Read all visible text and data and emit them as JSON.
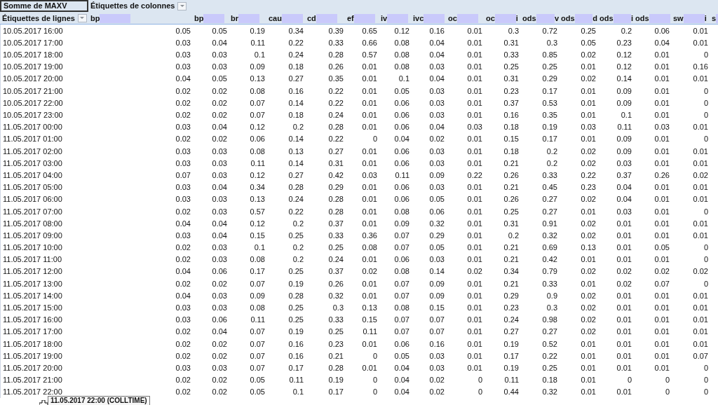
{
  "pivot": {
    "value_field": "Somme de MAXV",
    "column_labels": "Étiquettes de colonnes",
    "row_labels": "Étiquettes de lignes"
  },
  "columns": [
    {
      "prefix": "bp"
    },
    {
      "prefix": "bp"
    },
    {
      "prefix": "br"
    },
    {
      "prefix": "cau"
    },
    {
      "prefix": "cd"
    },
    {
      "prefix": "ef"
    },
    {
      "prefix": "iv"
    },
    {
      "prefix": "ivc"
    },
    {
      "prefix": "oc"
    },
    {
      "prefix": "oc",
      "suffix": "i"
    },
    {
      "prefix": "ods",
      "suffix": "v"
    },
    {
      "prefix": "ods",
      "suffix": "d"
    },
    {
      "prefix": "ods",
      "suffix": "i"
    },
    {
      "prefix": "ods"
    },
    {
      "prefix": "sw",
      "suffix": "i"
    },
    {
      "prefix": "s"
    }
  ],
  "rows": [
    {
      "label": "10.05.2017 16:00",
      "values": [
        "0.05",
        "0.05",
        "0.19",
        "0.34",
        "0.39",
        "0.65",
        "0.12",
        "0.16",
        "0.01",
        "0.3",
        "0.72",
        "0.25",
        "0.2",
        "0.06",
        "0.01"
      ]
    },
    {
      "label": "10.05.2017 17:00",
      "values": [
        "0.03",
        "0.04",
        "0.11",
        "0.22",
        "0.33",
        "0.66",
        "0.08",
        "0.04",
        "0.01",
        "0.31",
        "0.3",
        "0.05",
        "0.23",
        "0.04",
        "0.01"
      ]
    },
    {
      "label": "10.05.2017 18:00",
      "values": [
        "0.03",
        "0.03",
        "0.1",
        "0.24",
        "0.28",
        "0.57",
        "0.08",
        "0.04",
        "0.01",
        "0.33",
        "0.85",
        "0.02",
        "0.12",
        "0.01",
        "0"
      ]
    },
    {
      "label": "10.05.2017 19:00",
      "values": [
        "0.03",
        "0.03",
        "0.09",
        "0.18",
        "0.26",
        "0.01",
        "0.08",
        "0.03",
        "0.01",
        "0.25",
        "0.25",
        "0.01",
        "0.12",
        "0.01",
        "0.16"
      ]
    },
    {
      "label": "10.05.2017 20:00",
      "values": [
        "0.04",
        "0.05",
        "0.13",
        "0.27",
        "0.35",
        "0.01",
        "0.1",
        "0.04",
        "0.01",
        "0.31",
        "0.29",
        "0.02",
        "0.14",
        "0.01",
        "0.01"
      ]
    },
    {
      "label": "10.05.2017 21:00",
      "values": [
        "0.02",
        "0.02",
        "0.08",
        "0.16",
        "0.22",
        "0.01",
        "0.05",
        "0.03",
        "0.01",
        "0.23",
        "0.17",
        "0.01",
        "0.09",
        "0.01",
        "0"
      ]
    },
    {
      "label": "10.05.2017 22:00",
      "values": [
        "0.02",
        "0.02",
        "0.07",
        "0.14",
        "0.22",
        "0.01",
        "0.06",
        "0.03",
        "0.01",
        "0.37",
        "0.53",
        "0.01",
        "0.09",
        "0.01",
        "0"
      ]
    },
    {
      "label": "10.05.2017 23:00",
      "values": [
        "0.02",
        "0.02",
        "0.07",
        "0.18",
        "0.24",
        "0.01",
        "0.06",
        "0.03",
        "0.01",
        "0.16",
        "0.35",
        "0.01",
        "0.1",
        "0.01",
        "0"
      ]
    },
    {
      "label": "11.05.2017 00:00",
      "values": [
        "0.03",
        "0.04",
        "0.12",
        "0.2",
        "0.28",
        "0.01",
        "0.06",
        "0.04",
        "0.03",
        "0.18",
        "0.19",
        "0.03",
        "0.11",
        "0.03",
        "0.01"
      ]
    },
    {
      "label": "11.05.2017 01:00",
      "values": [
        "0.02",
        "0.02",
        "0.06",
        "0.14",
        "0.22",
        "0",
        "0.04",
        "0.02",
        "0.01",
        "0.15",
        "0.17",
        "0.01",
        "0.09",
        "0.01",
        "0"
      ]
    },
    {
      "label": "11.05.2017 02:00",
      "values": [
        "0.03",
        "0.03",
        "0.08",
        "0.13",
        "0.27",
        "0.01",
        "0.06",
        "0.03",
        "0.01",
        "0.18",
        "0.2",
        "0.02",
        "0.09",
        "0.01",
        "0.01"
      ]
    },
    {
      "label": "11.05.2017 03:00",
      "values": [
        "0.03",
        "0.03",
        "0.11",
        "0.14",
        "0.31",
        "0.01",
        "0.06",
        "0.03",
        "0.01",
        "0.21",
        "0.2",
        "0.02",
        "0.03",
        "0.01",
        "0.01"
      ]
    },
    {
      "label": "11.05.2017 04:00",
      "values": [
        "0.07",
        "0.03",
        "0.12",
        "0.27",
        "0.42",
        "0.03",
        "0.11",
        "0.09",
        "0.22",
        "0.26",
        "0.33",
        "0.22",
        "0.37",
        "0.26",
        "0.02"
      ]
    },
    {
      "label": "11.05.2017 05:00",
      "values": [
        "0.03",
        "0.04",
        "0.34",
        "0.28",
        "0.29",
        "0.01",
        "0.06",
        "0.03",
        "0.01",
        "0.21",
        "0.45",
        "0.23",
        "0.04",
        "0.01",
        "0.01"
      ]
    },
    {
      "label": "11.05.2017 06:00",
      "values": [
        "0.03",
        "0.03",
        "0.13",
        "0.24",
        "0.28",
        "0.01",
        "0.06",
        "0.05",
        "0.01",
        "0.26",
        "0.27",
        "0.02",
        "0.04",
        "0.01",
        "0.01"
      ]
    },
    {
      "label": "11.05.2017 07:00",
      "values": [
        "0.02",
        "0.03",
        "0.57",
        "0.22",
        "0.28",
        "0.01",
        "0.08",
        "0.06",
        "0.01",
        "0.25",
        "0.27",
        "0.01",
        "0.03",
        "0.01",
        "0"
      ]
    },
    {
      "label": "11.05.2017 08:00",
      "values": [
        "0.04",
        "0.04",
        "0.12",
        "0.2",
        "0.37",
        "0.01",
        "0.09",
        "0.32",
        "0.01",
        "0.31",
        "0.91",
        "0.02",
        "0.01",
        "0.01",
        "0.01"
      ]
    },
    {
      "label": "11.05.2017 09:00",
      "values": [
        "0.03",
        "0.04",
        "0.15",
        "0.25",
        "0.33",
        "0.36",
        "0.07",
        "0.29",
        "0.01",
        "0.2",
        "0.32",
        "0.02",
        "0.01",
        "0.01",
        "0.01"
      ]
    },
    {
      "label": "11.05.2017 10:00",
      "values": [
        "0.02",
        "0.03",
        "0.1",
        "0.2",
        "0.25",
        "0.08",
        "0.07",
        "0.05",
        "0.01",
        "0.21",
        "0.69",
        "0.13",
        "0.01",
        "0.05",
        "0"
      ]
    },
    {
      "label": "11.05.2017 11:00",
      "values": [
        "0.02",
        "0.03",
        "0.08",
        "0.2",
        "0.24",
        "0.01",
        "0.06",
        "0.03",
        "0.01",
        "0.21",
        "0.42",
        "0.01",
        "0.01",
        "0.01",
        "0"
      ]
    },
    {
      "label": "11.05.2017 12:00",
      "values": [
        "0.04",
        "0.06",
        "0.17",
        "0.25",
        "0.37",
        "0.02",
        "0.08",
        "0.14",
        "0.02",
        "0.34",
        "0.79",
        "0.02",
        "0.02",
        "0.02",
        "0.02"
      ]
    },
    {
      "label": "11.05.2017 13:00",
      "values": [
        "0.02",
        "0.02",
        "0.07",
        "0.19",
        "0.26",
        "0.01",
        "0.07",
        "0.09",
        "0.01",
        "0.21",
        "0.33",
        "0.01",
        "0.02",
        "0.07",
        "0"
      ]
    },
    {
      "label": "11.05.2017 14:00",
      "values": [
        "0.04",
        "0.03",
        "0.09",
        "0.28",
        "0.32",
        "0.01",
        "0.07",
        "0.09",
        "0.01",
        "0.29",
        "0.9",
        "0.02",
        "0.01",
        "0.01",
        "0.01"
      ]
    },
    {
      "label": "11.05.2017 15:00",
      "values": [
        "0.03",
        "0.03",
        "0.08",
        "0.25",
        "0.3",
        "0.13",
        "0.08",
        "0.15",
        "0.01",
        "0.23",
        "0.3",
        "0.02",
        "0.01",
        "0.01",
        "0.01"
      ]
    },
    {
      "label": "11.05.2017 16:00",
      "values": [
        "0.03",
        "0.06",
        "0.11",
        "0.25",
        "0.33",
        "0.15",
        "0.07",
        "0.07",
        "0.01",
        "0.24",
        "0.98",
        "0.02",
        "0.01",
        "0.01",
        "0.01"
      ]
    },
    {
      "label": "11.05.2017 17:00",
      "values": [
        "0.02",
        "0.04",
        "0.07",
        "0.19",
        "0.25",
        "0.11",
        "0.07",
        "0.07",
        "0.01",
        "0.27",
        "0.27",
        "0.02",
        "0.01",
        "0.01",
        "0.01"
      ]
    },
    {
      "label": "11.05.2017 18:00",
      "values": [
        "0.02",
        "0.02",
        "0.07",
        "0.16",
        "0.23",
        "0.01",
        "0.06",
        "0.16",
        "0.01",
        "0.19",
        "0.52",
        "0.01",
        "0.01",
        "0.01",
        "0.01"
      ]
    },
    {
      "label": "11.05.2017 19:00",
      "values": [
        "0.02",
        "0.02",
        "0.07",
        "0.16",
        "0.21",
        "0",
        "0.05",
        "0.03",
        "0.01",
        "0.17",
        "0.22",
        "0.01",
        "0.01",
        "0.01",
        "0.07"
      ]
    },
    {
      "label": "11.05.2017 20:00",
      "values": [
        "0.03",
        "0.03",
        "0.07",
        "0.17",
        "0.28",
        "0.01",
        "0.04",
        "0.03",
        "0.01",
        "0.19",
        "0.25",
        "0.01",
        "0.01",
        "0.01",
        "0"
      ]
    },
    {
      "label": "11.05.2017 21:00",
      "values": [
        "0.02",
        "0.02",
        "0.05",
        "0.11",
        "0.19",
        "0",
        "0.04",
        "0.02",
        "0",
        "0.11",
        "0.18",
        "0.01",
        "0",
        "0",
        "0"
      ]
    },
    {
      "label": "11.05.2017 22:00",
      "values": [
        "0.02",
        "0.02",
        "0.05",
        "0.1",
        "0.17",
        "0",
        "0.04",
        "0.02",
        "0",
        "0.44",
        "0.32",
        "0.01",
        "0.01",
        "0",
        "0"
      ]
    }
  ],
  "tooltip": "11.05.2017 22:00 (COLLTIME)"
}
